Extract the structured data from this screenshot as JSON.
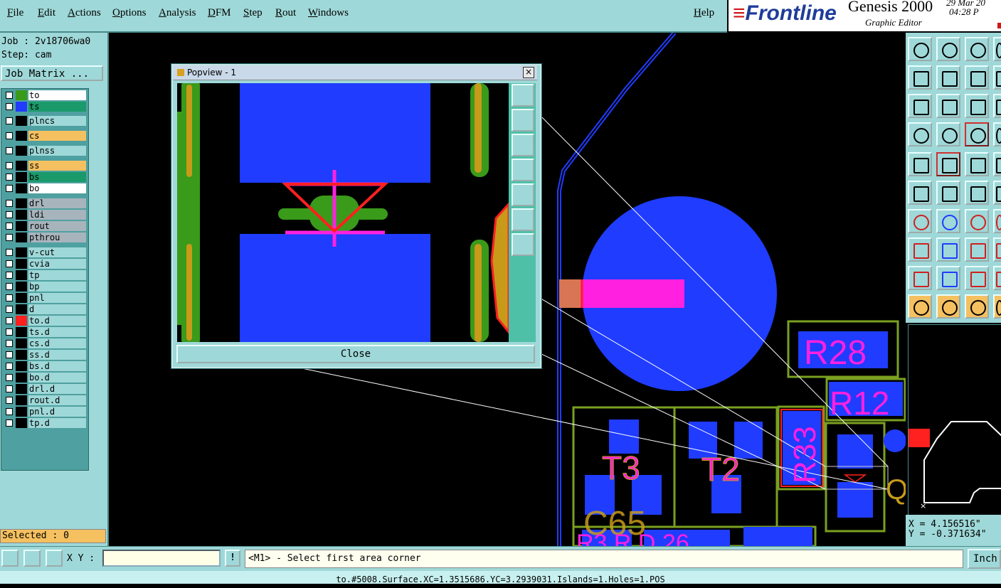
{
  "menu": {
    "items": [
      "File",
      "Edit",
      "Actions",
      "Options",
      "Analysis",
      "DFM",
      "Step",
      "Rout",
      "Windows"
    ],
    "help": "Help"
  },
  "brand": {
    "logo": "Frontline",
    "product": "Genesis 2000",
    "subtitle": "Graphic Editor",
    "date": "29 Mar 20",
    "time": "04:28 P"
  },
  "left": {
    "job": "Job : 2v18706wa0",
    "step": "Step: cam",
    "job_matrix": "Job Matrix ...",
    "selected": "Selected : 0",
    "layers": [
      {
        "name": "to",
        "swatch": "#3a9a1a",
        "bg": "#ffffff"
      },
      {
        "name": "ts",
        "swatch": "#1f3cff",
        "bg": "#1a9a6a"
      },
      {
        "name": "plncs",
        "swatch": "#000000",
        "bg": "#9fd8d8"
      },
      {
        "name": "cs",
        "swatch": "#000000",
        "bg": "#f5c060"
      },
      {
        "name": "plnss",
        "swatch": "#000000",
        "bg": "#9fd8d8"
      },
      {
        "name": "ss",
        "swatch": "#000000",
        "bg": "#f5c060"
      },
      {
        "name": "bs",
        "swatch": "#000000",
        "bg": "#1a9a6a"
      },
      {
        "name": "bo",
        "swatch": "#000000",
        "bg": "#ffffff"
      },
      {
        "name": "drl",
        "swatch": "#000000",
        "bg": "#a8b4bc"
      },
      {
        "name": "ldi",
        "swatch": "#000000",
        "bg": "#a8b4bc"
      },
      {
        "name": "rout",
        "swatch": "#000000",
        "bg": "#a8b4bc"
      },
      {
        "name": "pthrou",
        "swatch": "#000000",
        "bg": "#a8b4bc"
      },
      {
        "name": "v-cut",
        "swatch": "#000000",
        "bg": "#9fd8d8"
      },
      {
        "name": "cvia",
        "swatch": "#000000",
        "bg": "#9fd8d8"
      },
      {
        "name": "tp",
        "swatch": "#000000",
        "bg": "#9fd8d8"
      },
      {
        "name": "bp",
        "swatch": "#000000",
        "bg": "#9fd8d8"
      },
      {
        "name": "pnl",
        "swatch": "#000000",
        "bg": "#9fd8d8"
      },
      {
        "name": "d",
        "swatch": "#000000",
        "bg": "#9fd8d8"
      },
      {
        "name": "to.d",
        "swatch": "#ff2020",
        "bg": "#9fd8d8"
      },
      {
        "name": "ts.d",
        "swatch": "#000000",
        "bg": "#9fd8d8"
      },
      {
        "name": "cs.d",
        "swatch": "#000000",
        "bg": "#9fd8d8"
      },
      {
        "name": "ss.d",
        "swatch": "#000000",
        "bg": "#9fd8d8"
      },
      {
        "name": "bs.d",
        "swatch": "#000000",
        "bg": "#9fd8d8"
      },
      {
        "name": "bo.d",
        "swatch": "#000000",
        "bg": "#9fd8d8"
      },
      {
        "name": "drl.d",
        "swatch": "#000000",
        "bg": "#9fd8d8"
      },
      {
        "name": "rout.d",
        "swatch": "#000000",
        "bg": "#9fd8d8"
      },
      {
        "name": "pnl.d",
        "swatch": "#000000",
        "bg": "#9fd8d8"
      },
      {
        "name": "tp.d",
        "swatch": "#000000",
        "bg": "#9fd8d8"
      }
    ]
  },
  "popview": {
    "title": "Popview - 1",
    "close_x": "×",
    "close_button": "Close"
  },
  "board": {
    "refdes": [
      "R28",
      "R12",
      "R33",
      "T3",
      "T2",
      "Q"
    ]
  },
  "coords": {
    "x": "X = 4.156516\"",
    "y": "Y = -0.371634\""
  },
  "bottom": {
    "xy_label": "X Y :",
    "xy_value": "",
    "bang": "!",
    "message": "<M1> - Select first area corner",
    "units": "Inch"
  },
  "status": "to.#5008.Surface.XC=1.3515686.YC=3.2939031.Islands=1.Holes=1.POS",
  "colors": {
    "panel": "#9fd8d8",
    "copper_blue": "#1f3cff",
    "silk_magenta": "#ff20e0",
    "outline_green": "#3a9a1a",
    "highlight_red": "#ff2020",
    "mask_orange": "#c89a1a"
  }
}
